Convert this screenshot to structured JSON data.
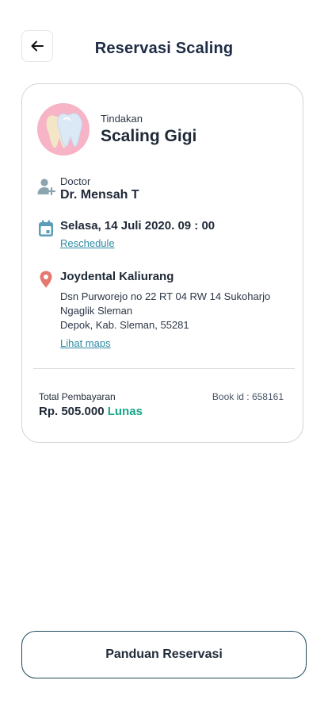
{
  "header": {
    "title": "Reservasi Scaling",
    "back_icon": "arrow-left-icon"
  },
  "treatment": {
    "label": "Tindakan",
    "name": "Scaling Gigi",
    "icon": "tooth-icon",
    "avatar_color": "#f6b4c6"
  },
  "doctor": {
    "label": "Doctor",
    "name": "Dr. Mensah T",
    "icon": "doctor-add-icon"
  },
  "schedule": {
    "date": "Selasa, 14 Juli 2020.",
    "time": "09 : 00",
    "reschedule_label": "Reschedule",
    "icon": "calendar-icon"
  },
  "location": {
    "clinic": "Joydental Kaliurang",
    "address_line1": "Dsn Purworejo no 22 RT 04 RW 14 Sukoharjo",
    "address_line2": "Ngaglik Sleman",
    "address_line3": "Depok, Kab. Sleman, 55281",
    "maps_label": "Lihat maps",
    "icon": "location-pin-icon",
    "pin_color": "#e5796f"
  },
  "payment": {
    "label": "Total Pembayaran",
    "amount": "Rp. 505.000",
    "status": "Lunas",
    "status_color": "#17a68a",
    "book_id": "Book id : 658161"
  },
  "footer": {
    "guide_label": "Panduan Reservasi"
  }
}
